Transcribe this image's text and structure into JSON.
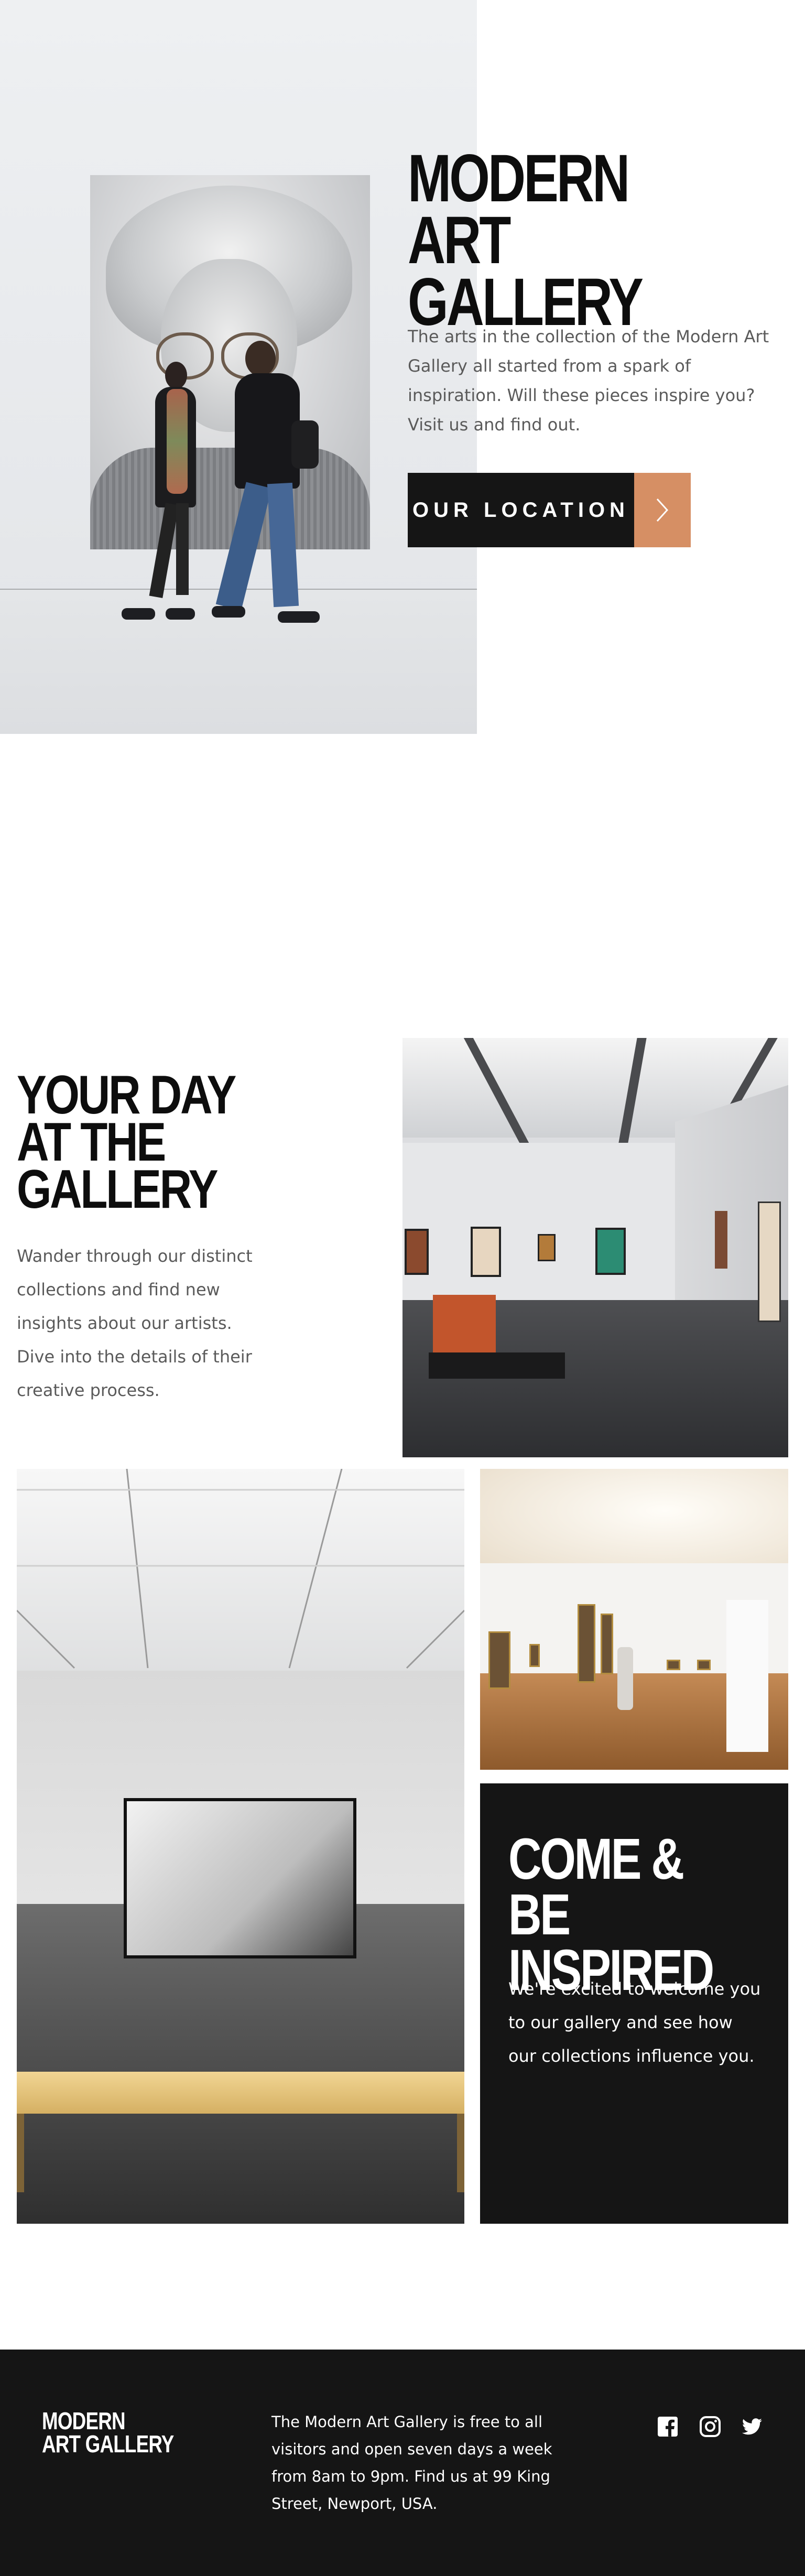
{
  "hero": {
    "title": "MODERN\nART GALLERY",
    "text": "The arts in the collection of the Modern Art Gallery all started from a spark of inspiration. Will these pieces inspire you? Visit us and find out.",
    "button_label": "OUR LOCATION",
    "button_icon": "chevron-right-icon",
    "image": "gallery-visitors-portrait-photo"
  },
  "day": {
    "title": "YOUR DAY\nAT THE\nGALLERY",
    "text": "Wander through our distinct collections and find new insights about our artists. Dive into the details of their creative process.",
    "image": "gallery-hall-photo"
  },
  "inspire": {
    "title": "COME & BE\nINSPIRED",
    "text": "We're excited to welcome you to our gallery and see how our collections influence you.",
    "images": [
      "gallery-bench-frame-photo",
      "gallery-corridor-photo"
    ]
  },
  "footer": {
    "logo": "MODERN\nART GALLERY",
    "text": "The Modern Art Gallery is free to all visitors and open seven days a week from 8am to 9pm. Find us at 99 King Street, Newport, USA.",
    "social": [
      "facebook-icon",
      "instagram-icon",
      "twitter-icon"
    ]
  },
  "colors": {
    "dark": "#151515",
    "accent": "#d68f64",
    "body_text": "#5a5a5a",
    "white": "#ffffff"
  }
}
